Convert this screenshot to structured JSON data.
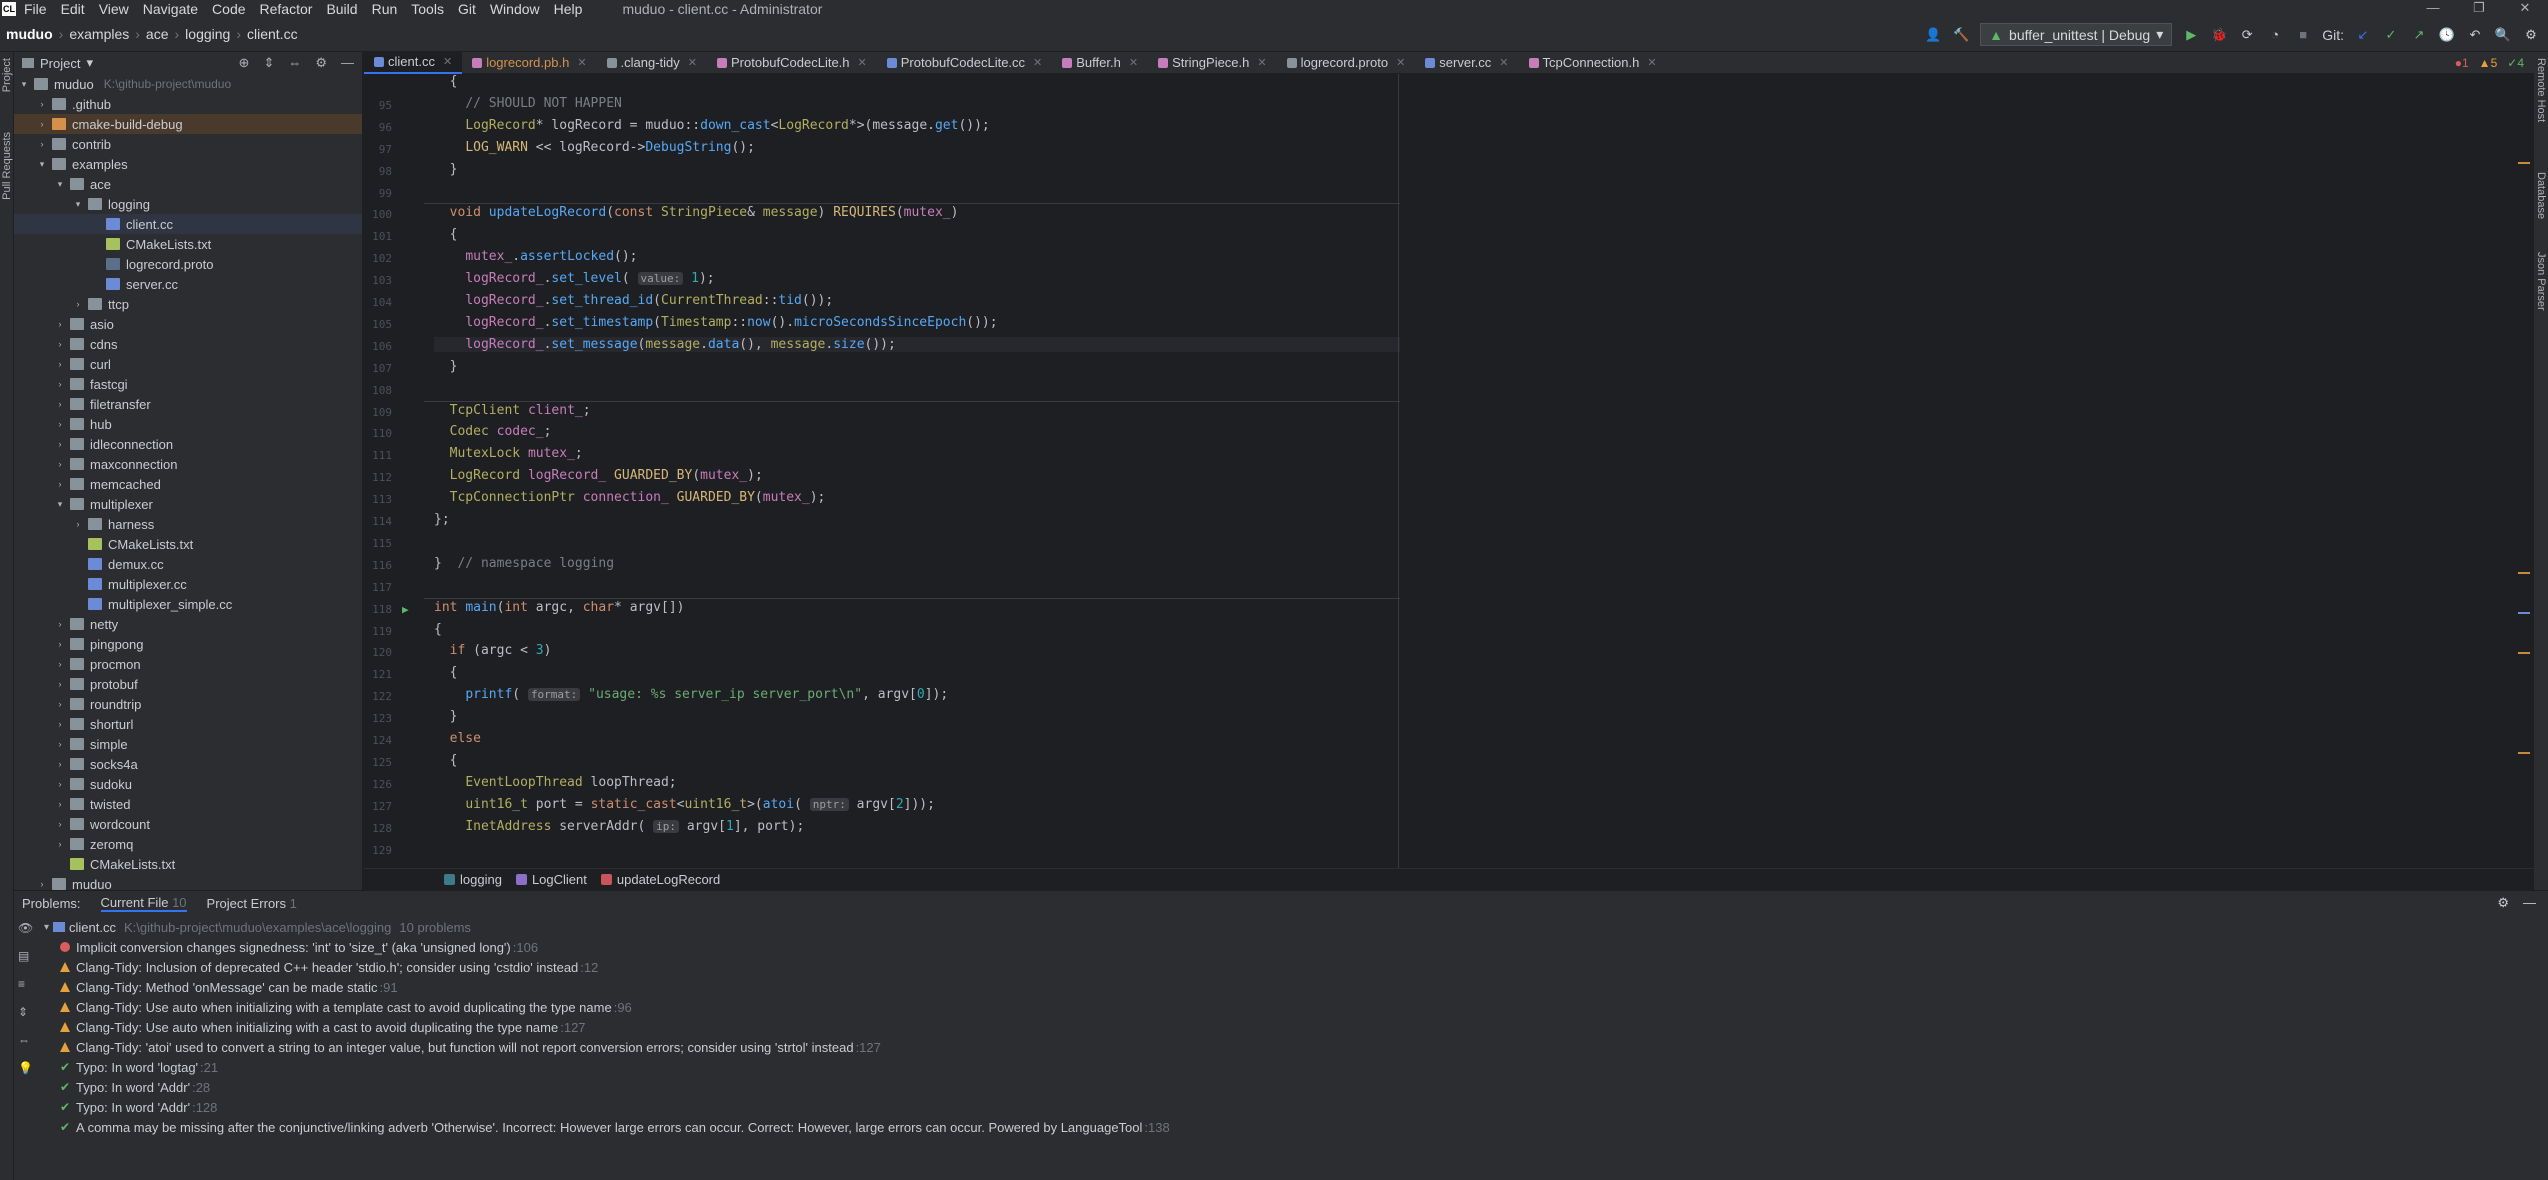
{
  "titlebar": {
    "menu": [
      "File",
      "Edit",
      "View",
      "Navigate",
      "Code",
      "Refactor",
      "Build",
      "Run",
      "Tools",
      "Git",
      "Window",
      "Help"
    ],
    "title": "muduo - client.cc - Administrator",
    "controls": [
      "—",
      "❐",
      "✕"
    ]
  },
  "navbar": {
    "breadcrumb": [
      "muduo",
      "examples",
      "ace",
      "logging",
      "client.cc"
    ],
    "run_config": "buffer_unittest | Debug",
    "git_label": "Git:"
  },
  "left_strip": [
    "Project",
    "Pull Requests"
  ],
  "right_strip": [
    "Remote Host",
    "Database",
    "Json Parser"
  ],
  "project": {
    "header": "Project",
    "tree": [
      {
        "label": "muduo",
        "hint": "K:\\github-project\\muduo",
        "depth": 0,
        "open": true,
        "type": "dir"
      },
      {
        "label": ".github",
        "depth": 1,
        "open": false,
        "type": "dir"
      },
      {
        "label": "cmake-build-debug",
        "depth": 1,
        "open": false,
        "type": "dir",
        "hl": true
      },
      {
        "label": "contrib",
        "depth": 1,
        "open": false,
        "type": "dir"
      },
      {
        "label": "examples",
        "depth": 1,
        "open": true,
        "type": "dir"
      },
      {
        "label": "ace",
        "depth": 2,
        "open": true,
        "type": "dir"
      },
      {
        "label": "logging",
        "depth": 3,
        "open": true,
        "type": "dir"
      },
      {
        "label": "client.cc",
        "depth": 4,
        "type": "cpp",
        "sel": true
      },
      {
        "label": "CMakeLists.txt",
        "depth": 4,
        "type": "txt"
      },
      {
        "label": "logrecord.proto",
        "depth": 4,
        "type": "file"
      },
      {
        "label": "server.cc",
        "depth": 4,
        "type": "cpp"
      },
      {
        "label": "ttcp",
        "depth": 3,
        "open": false,
        "type": "dir"
      },
      {
        "label": "asio",
        "depth": 2,
        "open": false,
        "type": "dir"
      },
      {
        "label": "cdns",
        "depth": 2,
        "open": false,
        "type": "dir"
      },
      {
        "label": "curl",
        "depth": 2,
        "open": false,
        "type": "dir"
      },
      {
        "label": "fastcgi",
        "depth": 2,
        "open": false,
        "type": "dir"
      },
      {
        "label": "filetransfer",
        "depth": 2,
        "open": false,
        "type": "dir"
      },
      {
        "label": "hub",
        "depth": 2,
        "open": false,
        "type": "dir"
      },
      {
        "label": "idleconnection",
        "depth": 2,
        "open": false,
        "type": "dir"
      },
      {
        "label": "maxconnection",
        "depth": 2,
        "open": false,
        "type": "dir"
      },
      {
        "label": "memcached",
        "depth": 2,
        "open": false,
        "type": "dir"
      },
      {
        "label": "multiplexer",
        "depth": 2,
        "open": true,
        "type": "dir"
      },
      {
        "label": "harness",
        "depth": 3,
        "open": false,
        "type": "dir"
      },
      {
        "label": "CMakeLists.txt",
        "depth": 3,
        "type": "txt"
      },
      {
        "label": "demux.cc",
        "depth": 3,
        "type": "cpp"
      },
      {
        "label": "multiplexer.cc",
        "depth": 3,
        "type": "cpp"
      },
      {
        "label": "multiplexer_simple.cc",
        "depth": 3,
        "type": "cpp"
      },
      {
        "label": "netty",
        "depth": 2,
        "open": false,
        "type": "dir"
      },
      {
        "label": "pingpong",
        "depth": 2,
        "open": false,
        "type": "dir"
      },
      {
        "label": "procmon",
        "depth": 2,
        "open": false,
        "type": "dir"
      },
      {
        "label": "protobuf",
        "depth": 2,
        "open": false,
        "type": "dir"
      },
      {
        "label": "roundtrip",
        "depth": 2,
        "open": false,
        "type": "dir"
      },
      {
        "label": "shorturl",
        "depth": 2,
        "open": false,
        "type": "dir"
      },
      {
        "label": "simple",
        "depth": 2,
        "open": false,
        "type": "dir"
      },
      {
        "label": "socks4a",
        "depth": 2,
        "open": false,
        "type": "dir"
      },
      {
        "label": "sudoku",
        "depth": 2,
        "open": false,
        "type": "dir"
      },
      {
        "label": "twisted",
        "depth": 2,
        "open": false,
        "type": "dir"
      },
      {
        "label": "wordcount",
        "depth": 2,
        "open": false,
        "type": "dir"
      },
      {
        "label": "zeromq",
        "depth": 2,
        "open": false,
        "type": "dir"
      },
      {
        "label": "CMakeLists.txt",
        "depth": 2,
        "type": "txt"
      },
      {
        "label": "muduo",
        "depth": 1,
        "open": false,
        "type": "dir"
      }
    ]
  },
  "tabs": [
    {
      "label": "client.cc",
      "active": true,
      "color": "#6b8bd6"
    },
    {
      "label": "logrecord.pb.h",
      "mod": true,
      "color": "#c77dbb"
    },
    {
      "label": ".clang-tidy",
      "color": "#87929b"
    },
    {
      "label": "ProtobufCodecLite.h",
      "color": "#c77dbb"
    },
    {
      "label": "ProtobufCodecLite.cc",
      "color": "#6b8bd6"
    },
    {
      "label": "Buffer.h",
      "color": "#c77dbb"
    },
    {
      "label": "StringPiece.h",
      "color": "#c77dbb"
    },
    {
      "label": "logrecord.proto",
      "color": "#87929b"
    },
    {
      "label": "server.cc",
      "color": "#6b8bd6"
    },
    {
      "label": "TcpConnection.h",
      "color": "#c77dbb"
    }
  ],
  "inspection": {
    "errors": "1",
    "warnings": "5",
    "ok": "4"
  },
  "code_lines": [
    {
      "n": "",
      "html": "  {"
    },
    {
      "n": "95",
      "html": "    <span class='cm'>// SHOULD NOT HAPPEN</span>"
    },
    {
      "n": "96",
      "html": "    <span class='ty'>LogRecord</span>* logRecord = <span class='ns'>muduo</span>::<span class='fn'>down_cast</span>&lt;<span class='ty'>LogRecord</span>*&gt;(message.<span class='fn'>get</span>());"
    },
    {
      "n": "97",
      "html": "    <span class='mac'>LOG_WARN</span> &lt;&lt; logRecord-&gt;<span class='fn'>DebugString</span>();"
    },
    {
      "n": "98",
      "html": "  }"
    },
    {
      "n": "99",
      "html": ""
    },
    {
      "n": "100",
      "html": "  <span class='kw'>void</span> <span class='fn'>updateLogRecord</span>(<span class='kw'>const</span> <span class='ty'>StringPiece</span>&amp; <span class='ty'>message</span>) <span class='mac'>REQUIRES</span>(<span class='mem'>mutex_</span>)"
    },
    {
      "n": "101",
      "html": "  {"
    },
    {
      "n": "102",
      "html": "    <span class='mem'>mutex_</span>.<span class='fn'>assertLocked</span>();"
    },
    {
      "n": "103",
      "html": "    <span class='mem'>logRecord_</span>.<span class='fn'>set_level</span>( <span class='par'>value:</span> <span class='num'>1</span>);"
    },
    {
      "n": "104",
      "html": "    <span class='mem'>logRecord_</span>.<span class='fn'>set_thread_id</span>(<span class='ty'>CurrentThread</span>::<span class='fn'>tid</span>());"
    },
    {
      "n": "105",
      "html": "    <span class='mem'>logRecord_</span>.<span class='fn'>set_timestamp</span>(<span class='ty'>Timestamp</span>::<span class='fn'>now</span>().<span class='fn'>microSecondsSinceEpoch</span>());"
    },
    {
      "n": "106",
      "html": "    <span class='mem'>logRecord_</span>.<span class='fn'>set_message</span>(<span class='ty'>message</span>.<span class='fn'>data</span>(), <span class='ty'>message</span>.<span class='fn'>size</span>());"
    },
    {
      "n": "107",
      "html": "  }"
    },
    {
      "n": "108",
      "html": ""
    },
    {
      "n": "109",
      "html": "  <span class='ty'>TcpClient</span> <span class='mem'>client_</span>;"
    },
    {
      "n": "110",
      "html": "  <span class='ty'>Codec</span> <span class='mem'>codec_</span>;"
    },
    {
      "n": "111",
      "html": "  <span class='ty'>MutexLock</span> <span class='mem'>mutex_</span>;"
    },
    {
      "n": "112",
      "html": "  <span class='ty'>LogRecord</span> <span class='mem'>logRecord_</span> <span class='mac'>GUARDED_BY</span>(<span class='mem'>mutex_</span>);"
    },
    {
      "n": "113",
      "html": "  <span class='ty'>TcpConnectionPtr</span> <span class='mem'>connection_</span> <span class='mac'>GUARDED_BY</span>(<span class='mem'>mutex_</span>);"
    },
    {
      "n": "114",
      "html": "};"
    },
    {
      "n": "115",
      "html": ""
    },
    {
      "n": "116",
      "html": "}  <span class='cm'>// namespace logging</span>"
    },
    {
      "n": "117",
      "html": ""
    },
    {
      "n": "118",
      "html": "<span class='kw'>int</span> <span class='fn'>main</span>(<span class='kw'>int</span> argc, <span class='kw'>char</span>* argv[])"
    },
    {
      "n": "119",
      "html": "{"
    },
    {
      "n": "120",
      "html": "  <span class='kw'>if</span> (argc &lt; <span class='num'>3</span>)"
    },
    {
      "n": "121",
      "html": "  {"
    },
    {
      "n": "122",
      "html": "    <span class='fn'>printf</span>( <span class='par'>format:</span> <span class='str'>\"usage: %s server_ip server_port\\n\"</span>, argv[<span class='num'>0</span>]);"
    },
    {
      "n": "123",
      "html": "  }"
    },
    {
      "n": "124",
      "html": "  <span class='kw'>else</span>"
    },
    {
      "n": "125",
      "html": "  {"
    },
    {
      "n": "126",
      "html": "    <span class='ty'>EventLoopThread</span> loopThread;"
    },
    {
      "n": "127",
      "html": "    <span class='ty'>uint16_t</span> port = <span class='kw'>static_cast</span>&lt;<span class='ty'>uint16_t</span>&gt;(<span class='fn'>atoi</span>( <span class='par'>nptr:</span> argv[<span class='num'>2</span>]));"
    },
    {
      "n": "128",
      "html": "    <span class='ty'>InetAddress</span> serverAddr( <span class='par'>ip:</span> argv[<span class='num'>1</span>], port);"
    },
    {
      "n": "129",
      "html": ""
    }
  ],
  "code_breadcrumb": [
    "logging",
    "LogClient",
    "updateLogRecord"
  ],
  "problems": {
    "tabs": [
      "Problems:",
      "Current File",
      "10",
      "Project Errors",
      "1"
    ],
    "file": "client.cc",
    "path": "K:\\github-project\\muduo\\examples\\ace\\logging",
    "count": "10 problems",
    "items": [
      {
        "kind": "err",
        "text": "Implicit conversion changes signedness: 'int' to 'size_t' (aka 'unsigned long')",
        "loc": ":106"
      },
      {
        "kind": "warn",
        "text": "Clang-Tidy: Inclusion of deprecated C++ header 'stdio.h'; consider using 'cstdio' instead",
        "loc": ":12"
      },
      {
        "kind": "warn",
        "text": "Clang-Tidy: Method 'onMessage' can be made static",
        "loc": ":91"
      },
      {
        "kind": "warn",
        "text": "Clang-Tidy: Use auto when initializing with a template cast to avoid duplicating the type name",
        "loc": ":96"
      },
      {
        "kind": "warn",
        "text": "Clang-Tidy: Use auto when initializing with a cast to avoid duplicating the type name",
        "loc": ":127"
      },
      {
        "kind": "warn",
        "text": "Clang-Tidy: 'atoi' used to convert a string to an integer value, but function will not report conversion errors; consider using 'strtol' instead",
        "loc": ":127"
      },
      {
        "kind": "ok",
        "text": "Typo: In word 'logtag'",
        "loc": ":21"
      },
      {
        "kind": "ok",
        "text": "Typo: In word 'Addr'",
        "loc": ":28"
      },
      {
        "kind": "ok",
        "text": "Typo: In word 'Addr'",
        "loc": ":128"
      },
      {
        "kind": "ok",
        "text": "A comma may be missing after the conjunctive/linking adverb 'Otherwise'. Incorrect: However large errors can occur. Correct: However, large errors can occur. Powered by LanguageTool",
        "loc": ":138"
      }
    ]
  }
}
